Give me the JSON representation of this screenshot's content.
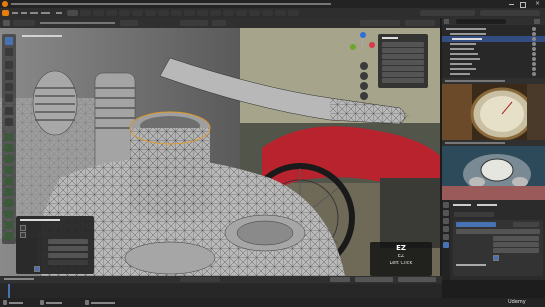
{
  "top_bar": {
    "tabs_count": 18,
    "active_tab_index": 0
  },
  "viewport": {
    "mesh_color": "#b8b8b8",
    "wire_color": "#2b2b2b",
    "photo_red": "#b9232e",
    "key_overlay": {
      "key": "EZ",
      "sub": "EZ",
      "action": "Left Click"
    }
  },
  "right_panels": {
    "outliner_rows": 11,
    "properties_rows": 6
  },
  "colors": {
    "accent": "#4772b3",
    "panel": "#2b2b2b",
    "header": "#232323",
    "selected": "#334d80"
  },
  "watermark": {
    "brand": "Udemy"
  }
}
